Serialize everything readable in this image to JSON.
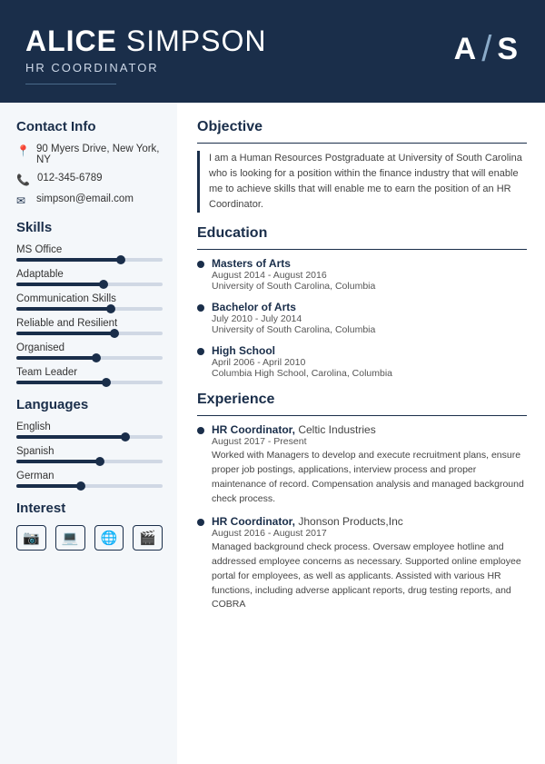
{
  "header": {
    "first_name": "ALICE",
    "last_name": "SIMPSON",
    "title": "HR COORDINATOR",
    "monogram_a": "A",
    "monogram_s": "S"
  },
  "contact": {
    "section_title": "Contact Info",
    "address": "90 Myers Drive, New York, NY",
    "phone": "012-345-6789",
    "email": "simpson@email.com"
  },
  "skills": {
    "section_title": "Skills",
    "items": [
      {
        "name": "MS Office",
        "percent": 72
      },
      {
        "name": "Adaptable",
        "percent": 60
      },
      {
        "name": "Communication Skills",
        "percent": 65
      },
      {
        "name": "Reliable and Resilient",
        "percent": 68
      },
      {
        "name": "Organised",
        "percent": 55
      },
      {
        "name": "Team Leader",
        "percent": 62
      }
    ]
  },
  "languages": {
    "section_title": "Languages",
    "items": [
      {
        "name": "English",
        "percent": 75
      },
      {
        "name": "Spanish",
        "percent": 58
      },
      {
        "name": "German",
        "percent": 45
      }
    ]
  },
  "interest": {
    "section_title": "Interest",
    "icons": [
      "📷",
      "💻",
      "🌐",
      "🎬"
    ]
  },
  "objective": {
    "section_title": "Objective",
    "text": "I am a Human Resources Postgraduate at University of South Carolina who is looking for a position within the finance industry that will enable me to achieve skills that will enable me to earn the position of an HR Coordinator."
  },
  "education": {
    "section_title": "Education",
    "items": [
      {
        "degree": "Masters of Arts",
        "dates": "August 2014 - August 2016",
        "school": "University of South Carolina, Columbia"
      },
      {
        "degree": "Bachelor of Arts",
        "dates": "July 2010 - July 2014",
        "school": "University of South Carolina, Columbia"
      },
      {
        "degree": "High School",
        "dates": "April 2006 - April 2010",
        "school": "Columbia High School, Carolina, Columbia"
      }
    ]
  },
  "experience": {
    "section_title": "Experience",
    "items": [
      {
        "role": "HR Coordinator",
        "company": "Celtic Industries",
        "dates": "August 2017 - Present",
        "desc": "Worked with Managers to develop and execute recruitment plans, ensure proper job postings, applications, interview process and proper maintenance of record. Compensation analysis and managed background check process."
      },
      {
        "role": "HR Coordinator",
        "company": "Jhonson Products,Inc",
        "dates": "August 2016 - August 2017",
        "desc": "Managed background check process. Oversaw employee hotline and addressed employee concerns as necessary. Supported online employee portal for employees, as well as applicants. Assisted with various HR functions, including adverse applicant reports, drug testing reports, and COBRA"
      }
    ]
  }
}
